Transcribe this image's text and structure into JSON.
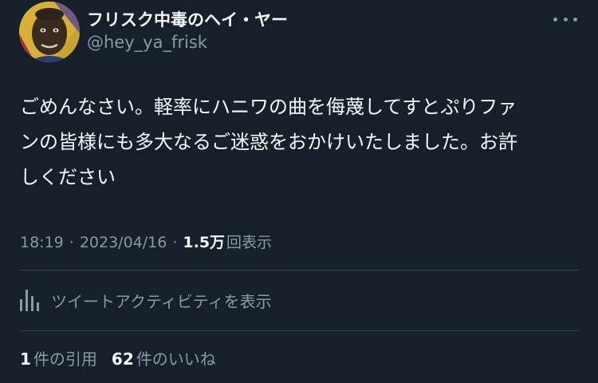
{
  "author": {
    "display_name": "フリスク中毒のヘイ・ヤー",
    "handle": "@hey_ya_frisk"
  },
  "tweet": {
    "text_lines": [
      "ごめんなさい。軽率にハニワの曲を侮蔑してすとぷりファ",
      "ンの皆様にも多大なるご迷惑をおかけいたしました。お許",
      "しください"
    ]
  },
  "meta": {
    "time": "18:19",
    "separator": "·",
    "date": "2023/04/16",
    "views_count": "1.5万",
    "views_label": "回表示"
  },
  "activity": {
    "label": "ツイートアクティビティを表示",
    "icon": "analytics-icon"
  },
  "stats": {
    "quotes_count": "1",
    "quotes_label": "件の引用",
    "likes_count": "62",
    "likes_label": "件のいいね"
  },
  "colors": {
    "background": "#15202b",
    "primary_text": "#f7f9f9",
    "secondary_text": "#8b98a5",
    "divider": "#38444d"
  }
}
